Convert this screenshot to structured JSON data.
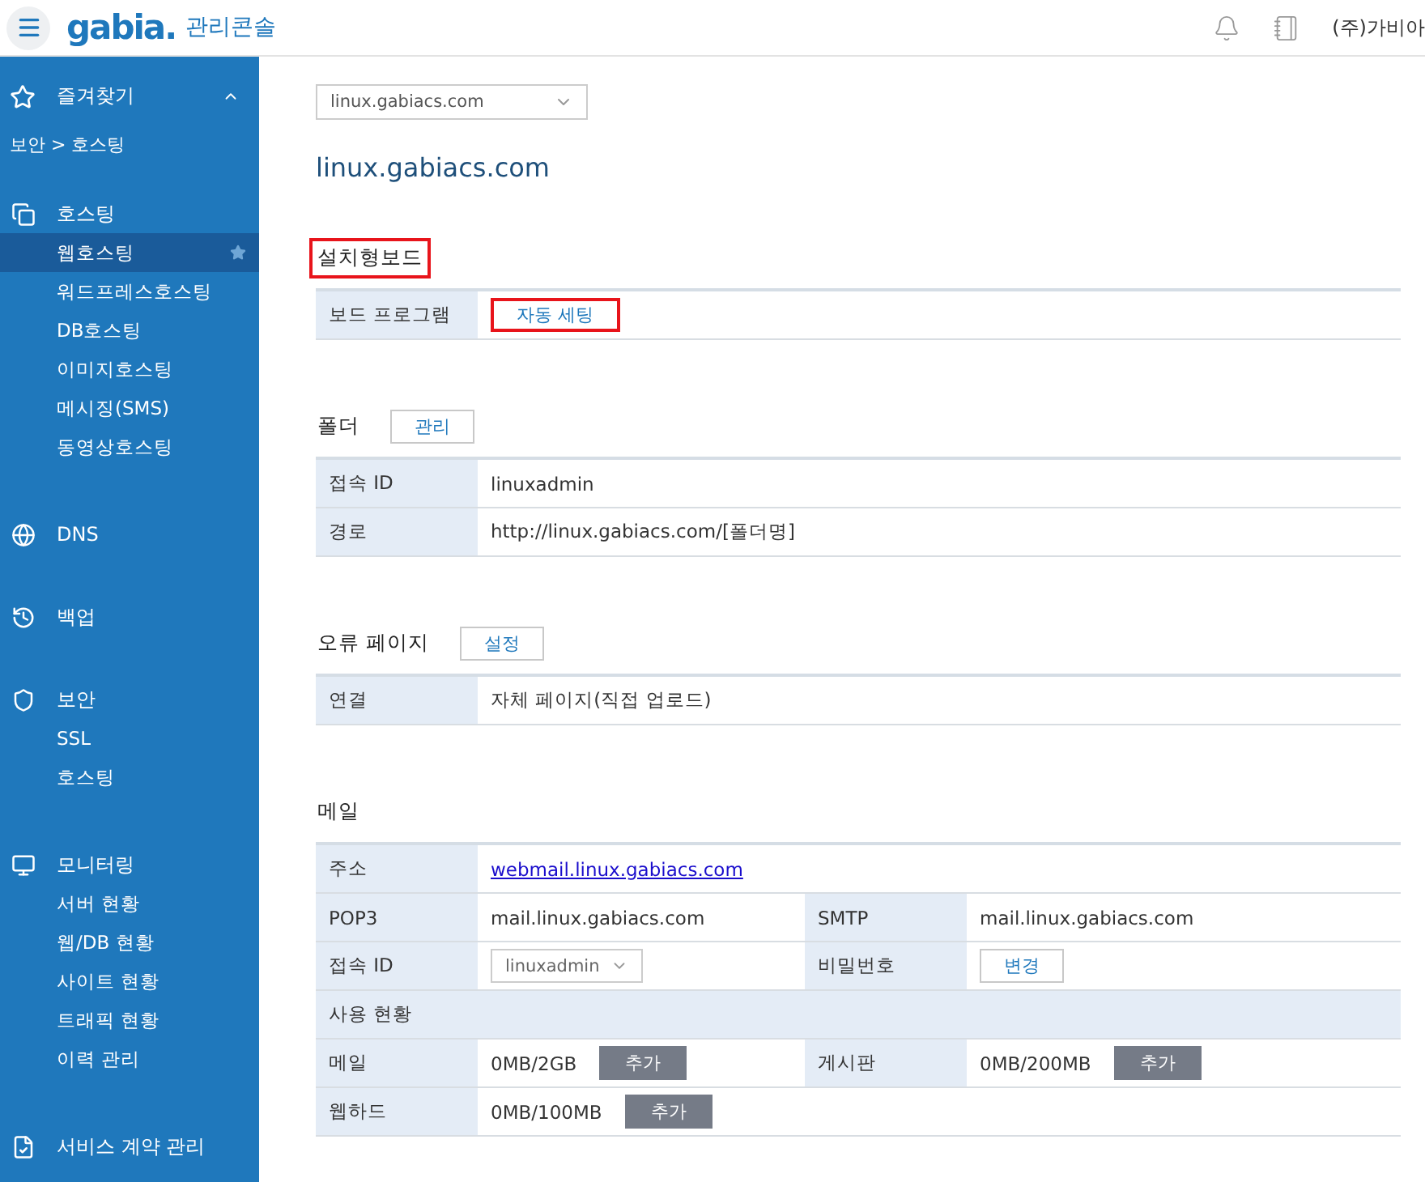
{
  "header": {
    "logo": "gabia.",
    "title": "관리콘솔",
    "account": "(주)가비아"
  },
  "sidebar": {
    "favorites": {
      "label": "즐겨찾기",
      "expanded": true,
      "breadcrumb": "보안 > 호스팅"
    },
    "groups": [
      {
        "label": "호스팅",
        "items": [
          {
            "label": "웹호스팅",
            "selected": true
          },
          {
            "label": "워드프레스호스팅",
            "selected": false
          },
          {
            "label": "DB호스팅",
            "selected": false
          },
          {
            "label": "이미지호스팅",
            "selected": false
          },
          {
            "label": "메시징(SMS)",
            "selected": false
          },
          {
            "label": "동영상호스팅",
            "selected": false
          }
        ]
      },
      {
        "label": "DNS"
      },
      {
        "label": "백업"
      },
      {
        "label": "보안",
        "items": [
          {
            "label": "SSL",
            "selected": false
          },
          {
            "label": "호스팅",
            "selected": false
          }
        ]
      },
      {
        "label": "모니터링",
        "items": [
          {
            "label": "서버 현황",
            "selected": false
          },
          {
            "label": "웹/DB 현황",
            "selected": false
          },
          {
            "label": "사이트 현황",
            "selected": false
          },
          {
            "label": "트래픽 현황",
            "selected": false
          },
          {
            "label": "이력 관리",
            "selected": false
          }
        ]
      },
      {
        "label": "서비스 계약 관리"
      }
    ]
  },
  "domain_select": {
    "value": "linux.gabiacs.com"
  },
  "page_title": "linux.gabiacs.com",
  "sections": [
    {
      "title": "설치형보드",
      "highlighted": true,
      "rows": [
        [
          {
            "kind": "label",
            "text": "보드 프로그램"
          },
          {
            "kind": "button",
            "text": "자동 세팅",
            "highlighted": true
          }
        ]
      ]
    },
    {
      "title": "폴더",
      "highlighted": false,
      "button": "관리",
      "rows": [
        [
          {
            "kind": "label",
            "text": "접속 ID"
          },
          {
            "kind": "text",
            "text": "linuxadmin"
          }
        ],
        [
          {
            "kind": "label",
            "text": "경로"
          },
          {
            "kind": "text",
            "text": "http://linux.gabiacs.com/[폴더명]"
          }
        ]
      ]
    },
    {
      "title": "오류 페이지",
      "highlighted": false,
      "button": "설정",
      "rows": [
        [
          {
            "kind": "label",
            "text": "연결"
          },
          {
            "kind": "text",
            "text": "자체 페이지(직접 업로드)"
          }
        ]
      ]
    },
    {
      "title": "메일",
      "highlighted": false,
      "rows": [
        [
          {
            "kind": "label",
            "text": "주소"
          },
          {
            "kind": "link",
            "text": "webmail.linux.gabiacs.com"
          }
        ],
        [
          {
            "kind": "label",
            "text": "POP3"
          },
          {
            "kind": "text",
            "text": "mail.linux.gabiacs.com"
          },
          {
            "kind": "label",
            "text": "SMTP"
          },
          {
            "kind": "text",
            "text": "mail.linux.gabiacs.com"
          }
        ],
        [
          {
            "kind": "label",
            "text": "접속 ID"
          },
          {
            "kind": "select",
            "text": "linuxadmin"
          },
          {
            "kind": "label",
            "text": "비밀번호"
          },
          {
            "kind": "button",
            "text": "변경",
            "highlighted": false
          }
        ],
        [
          {
            "kind": "group",
            "text": "사용 현황"
          }
        ],
        [
          {
            "kind": "label",
            "text": "메일"
          },
          {
            "kind": "usage",
            "text": "0MB/2GB",
            "button": "추가"
          },
          {
            "kind": "label",
            "text": "게시판"
          },
          {
            "kind": "usage",
            "text": "0MB/200MB",
            "button": "추가"
          }
        ],
        [
          {
            "kind": "label",
            "text": "웹하드"
          },
          {
            "kind": "usage",
            "text": "0MB/100MB",
            "button": "추가"
          }
        ]
      ]
    }
  ]
}
